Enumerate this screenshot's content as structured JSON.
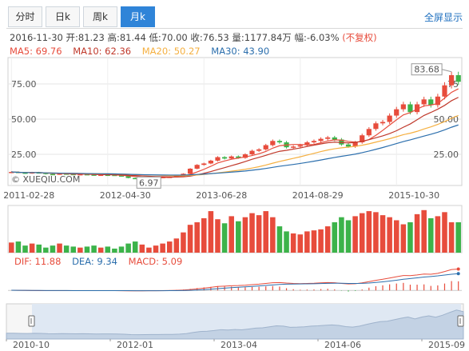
{
  "tabs": [
    {
      "label": "分时",
      "active": false
    },
    {
      "label": "日k",
      "active": false
    },
    {
      "label": "周k",
      "active": false
    },
    {
      "label": "月k",
      "active": true
    }
  ],
  "fullscreen_label": "全屏显示",
  "info": {
    "date": "2016-11-30",
    "open_label": "开:",
    "open": "81.23",
    "high_label": "高:",
    "high": "81.44",
    "low_label": "低:",
    "low": "70.00",
    "close_label": "收:",
    "close": "76.53",
    "volume_label": "量:",
    "volume": "1177.84万",
    "change_label": "幅:",
    "change": "-6.03%",
    "adjust": "(不复权)"
  },
  "ma_legend": [
    {
      "label": "MA5: 69.76",
      "color": "#e74c3c"
    },
    {
      "label": "MA10: 62.36",
      "color": "#c0392b"
    },
    {
      "label": "MA20: 50.27",
      "color": "#f5b041"
    },
    {
      "label": "MA30: 43.90",
      "color": "#2c6fad"
    }
  ],
  "macd_legend": [
    {
      "label": "DIF: 11.88",
      "color": "#e74c3c"
    },
    {
      "label": "DEA: 9.34",
      "color": "#2c6fad"
    },
    {
      "label": "MACD: 5.09",
      "color": "#e74c3c"
    }
  ],
  "watermark": "© XUEQIU.COM",
  "max_label": "83.68",
  "min_label": "6.97",
  "colors": {
    "up": "#e74c3c",
    "down": "#3cb34a",
    "ma5": "#e74c3c",
    "ma10": "#c0392b",
    "ma20": "#f5b041",
    "ma30": "#2c6fad",
    "accent": "#2f84d8"
  },
  "chart_data": {
    "type": "candlestick",
    "y_left_ticks": [
      "75.00",
      "50.00",
      "25.00"
    ],
    "y_right_ticks": [
      "75",
      "50.00",
      "25.00"
    ],
    "y_tick_values": [
      75,
      50,
      25
    ],
    "ylim": [
      4,
      92
    ],
    "x_ticks": [
      "2011-02-28",
      "2012-04-30",
      "2013-06-28",
      "2014-08-29",
      "2015-10-30"
    ],
    "x_tick_index": [
      0,
      14,
      28,
      42,
      56
    ],
    "navigator_ticks": [
      "2010-10",
      "2012-01",
      "2013-04",
      "2014-06",
      "2015-09"
    ],
    "navigator_tick_index": [
      0,
      15,
      30,
      45,
      60
    ],
    "close": [
      12.5,
      12.0,
      11.5,
      12.2,
      11.8,
      11.0,
      10.8,
      11.3,
      11.0,
      10.6,
      10.9,
      10.6,
      10.2,
      10.5,
      10.4,
      10.0,
      9.5,
      8.2,
      8.0,
      8.3,
      8.5,
      8.7,
      8.9,
      9.0,
      9.8,
      11.2,
      14.8,
      17.5,
      18.5,
      20.5,
      23.0,
      22.0,
      23.5,
      22.5,
      25.0,
      27.5,
      28.5,
      31.5,
      34.5,
      33.5,
      30.0,
      30.5,
      31.5,
      33.5,
      34.5,
      36.0,
      37.0,
      35.5,
      32.0,
      30.5,
      33.5,
      38.5,
      43.0,
      47.0,
      48.0,
      52.5,
      57.0,
      60.5,
      55.0,
      60.5,
      64.0,
      60.0,
      66.0,
      74.0,
      81.2,
      76.5
    ],
    "volume": [
      20,
      22,
      14,
      18,
      16,
      10,
      14,
      18,
      14,
      12,
      10,
      12,
      14,
      10,
      12,
      8,
      12,
      18,
      22,
      16,
      10,
      14,
      18,
      22,
      28,
      40,
      55,
      60,
      68,
      82,
      66,
      58,
      72,
      62,
      70,
      78,
      74,
      82,
      70,
      52,
      42,
      38,
      36,
      42,
      44,
      46,
      52,
      60,
      70,
      64,
      72,
      78,
      82,
      80,
      74,
      70,
      64,
      56,
      60,
      76,
      84,
      68,
      72,
      80,
      60,
      60
    ],
    "vol_max": 90,
    "macd": {
      "dif": [
        0.1,
        0.05,
        0,
        -0.05,
        -0.1,
        -0.12,
        -0.1,
        -0.1,
        -0.12,
        -0.12,
        -0.1,
        -0.1,
        -0.12,
        -0.1,
        -0.1,
        -0.12,
        -0.15,
        -0.2,
        -0.22,
        -0.2,
        -0.18,
        -0.15,
        -0.1,
        -0.05,
        0.05,
        0.2,
        0.5,
        0.9,
        1.3,
        1.7,
        2.2,
        2.4,
        2.6,
        2.7,
        2.9,
        3.2,
        3.5,
        3.9,
        4.3,
        4.4,
        4.1,
        3.9,
        3.8,
        3.9,
        4.0,
        4.2,
        4.4,
        4.3,
        3.9,
        3.6,
        3.7,
        4.2,
        4.9,
        5.6,
        6.2,
        6.9,
        7.6,
        8.3,
        8.2,
        8.6,
        9.1,
        9.0,
        9.5,
        10.5,
        11.6,
        11.88
      ],
      "dea": [
        0.1,
        0.08,
        0.05,
        0.02,
        -0.02,
        -0.05,
        -0.06,
        -0.07,
        -0.08,
        -0.09,
        -0.09,
        -0.09,
        -0.1,
        -0.1,
        -0.1,
        -0.1,
        -0.11,
        -0.13,
        -0.15,
        -0.16,
        -0.16,
        -0.16,
        -0.15,
        -0.13,
        -0.1,
        -0.04,
        0.07,
        0.24,
        0.45,
        0.7,
        1.0,
        1.28,
        1.54,
        1.77,
        2.0,
        2.24,
        2.49,
        2.77,
        3.07,
        3.33,
        3.48,
        3.56,
        3.61,
        3.66,
        3.73,
        3.82,
        3.94,
        4.01,
        3.99,
        3.91,
        3.87,
        3.94,
        4.13,
        4.43,
        4.78,
        5.2,
        5.68,
        6.2,
        6.6,
        7.0,
        7.42,
        7.74,
        8.1,
        8.58,
        9.0,
        9.34
      ],
      "ylim": [
        -3,
        13
      ]
    },
    "navigator_close": [
      12.5,
      12.5,
      12.0,
      11.5,
      12.2,
      11.8,
      11.0,
      10.8,
      11.3,
      11.0,
      10.6,
      10.9,
      10.6,
      10.2,
      10.5,
      10.4,
      10.0,
      9.5,
      8.2,
      8.0,
      8.3,
      8.5,
      8.7,
      8.9,
      9.0,
      9.8,
      11.2,
      14.8,
      17.5,
      18.5,
      20.5,
      23.0,
      22.0,
      23.5,
      22.5,
      25.0,
      27.5,
      28.5,
      31.5,
      34.5,
      33.5,
      30.0,
      30.5,
      31.5,
      33.5,
      34.5,
      36.0,
      37.0,
      35.5,
      32.0,
      30.5,
      33.5,
      38.5,
      43.0,
      47.0,
      48.0,
      52.5,
      57.0,
      60.5,
      55.0,
      60.5,
      64.0,
      60.0,
      66.0,
      74.0,
      81.2,
      76.5
    ]
  }
}
